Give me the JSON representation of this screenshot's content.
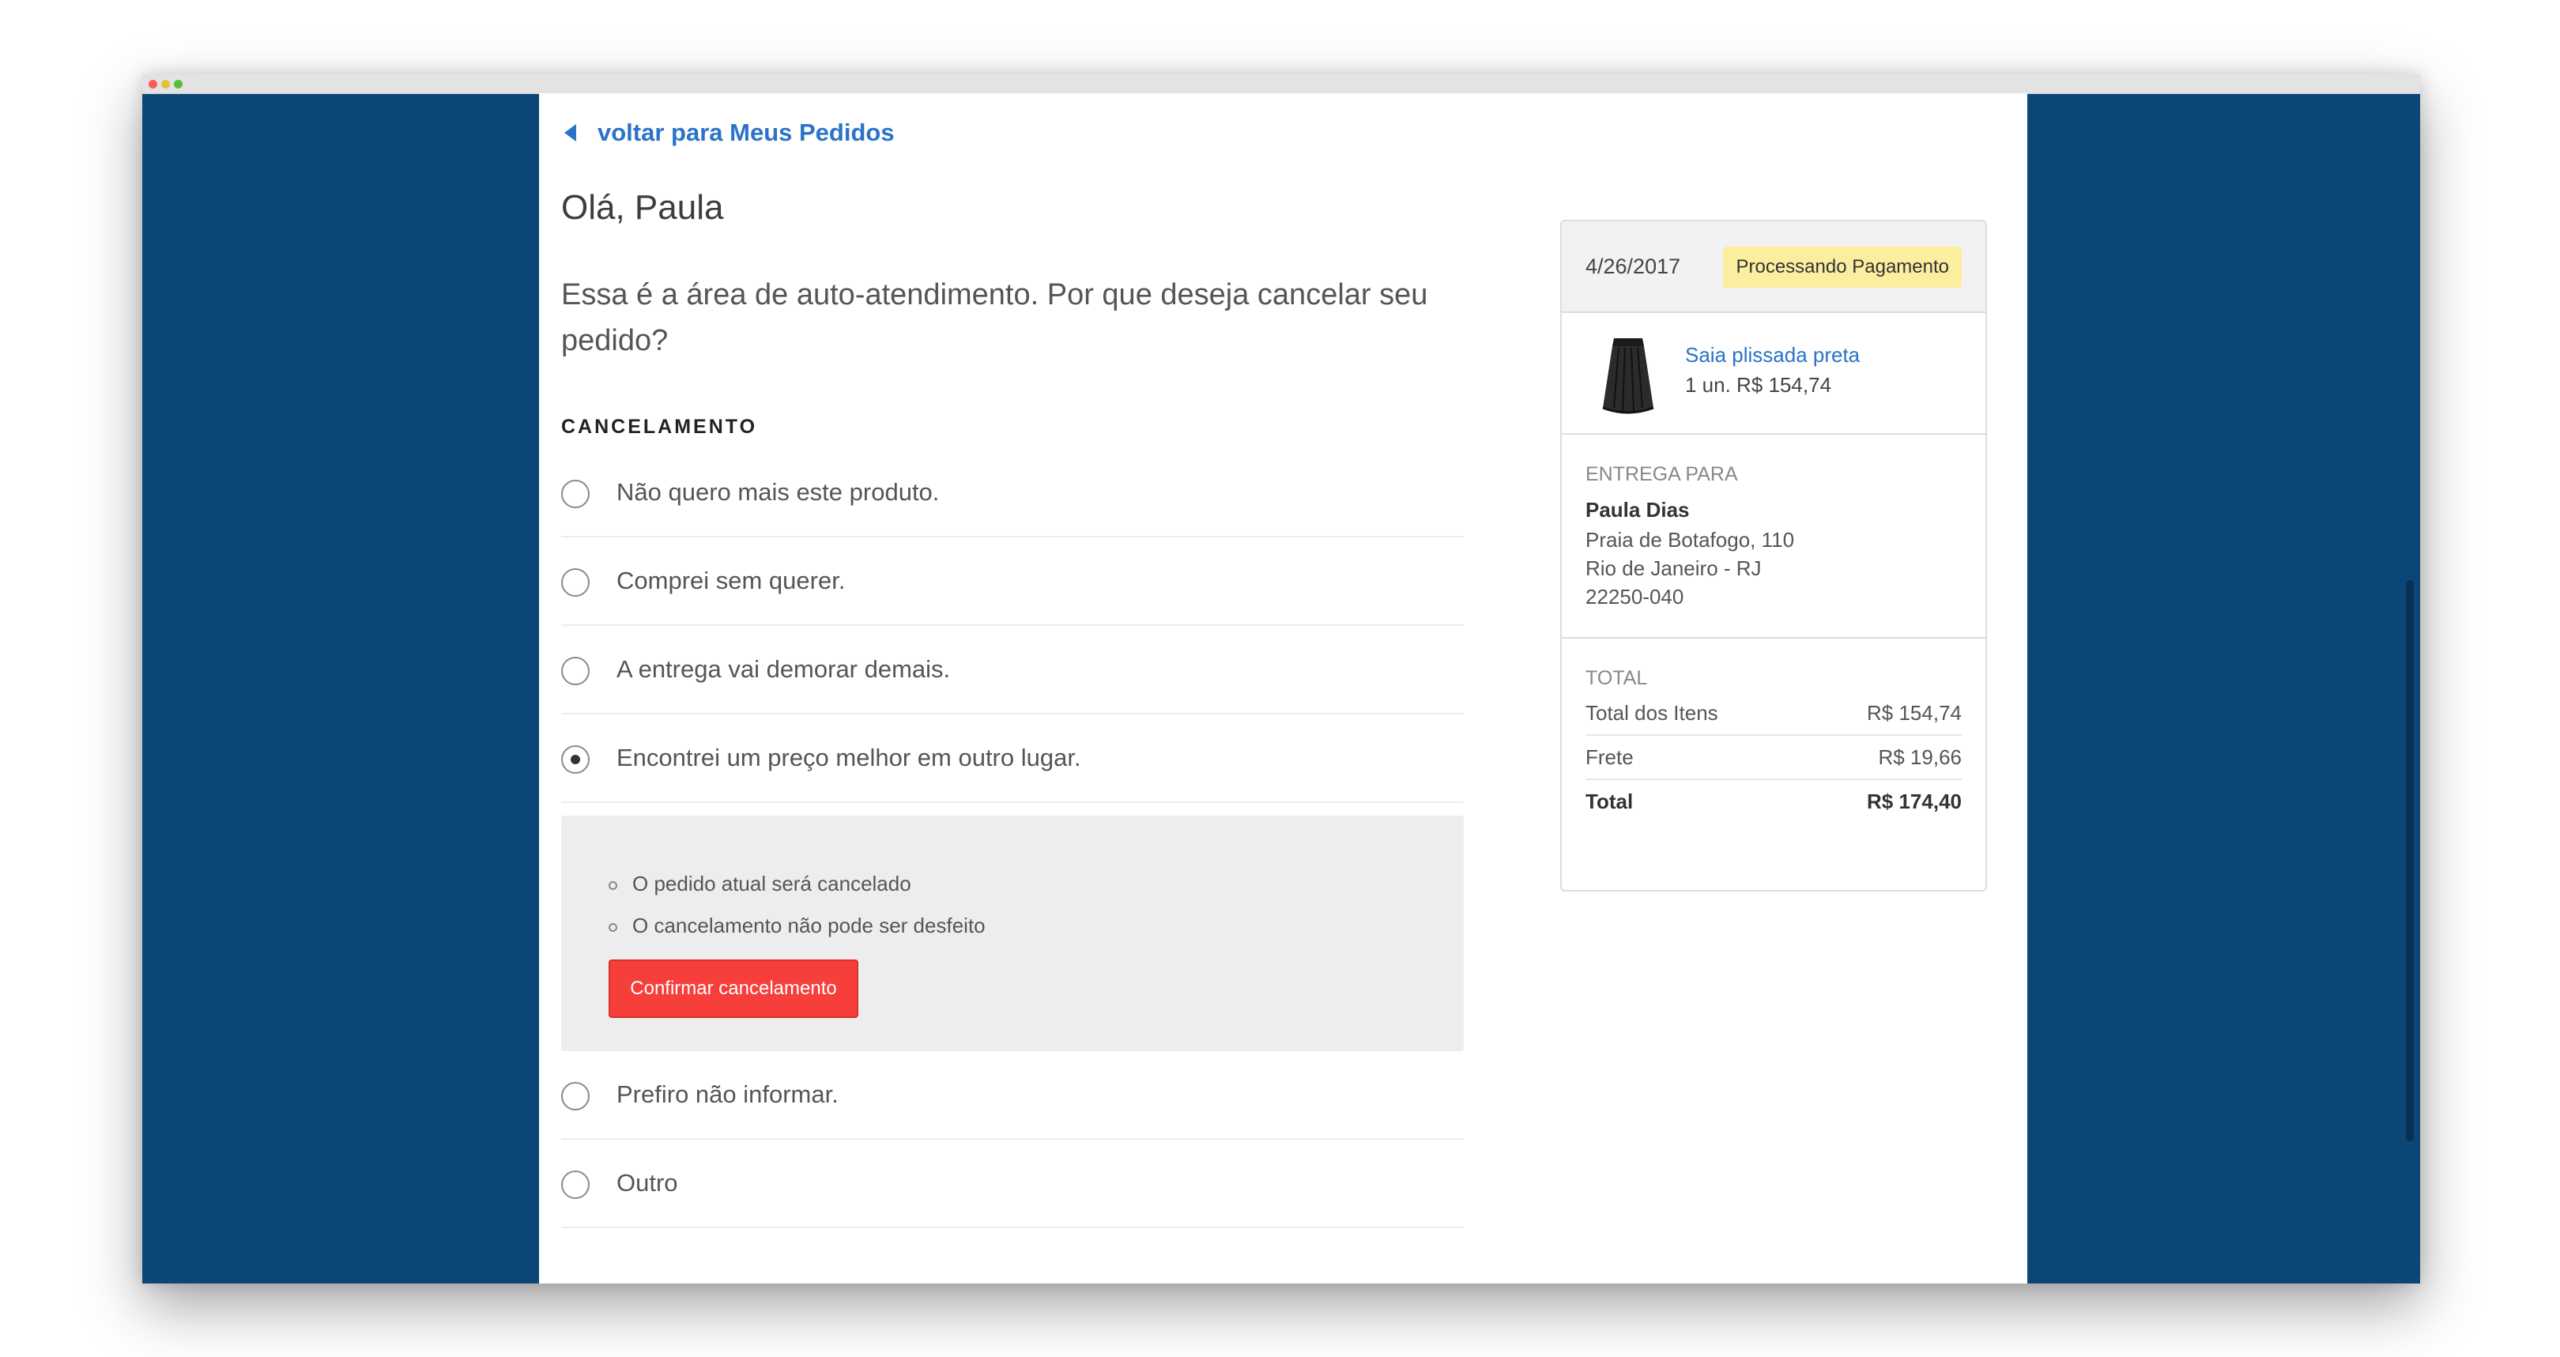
{
  "page": {
    "back_link": "voltar para Meus Pedidos",
    "greeting": "Olá, Paula",
    "intro": "Essa é a área de auto-atendimento. Por que deseja cancelar seu pedido?",
    "section_title": "CANCELAMENTO"
  },
  "options": [
    {
      "label": "Não quero mais este produto.",
      "selected": false
    },
    {
      "label": "Comprei sem querer.",
      "selected": false
    },
    {
      "label": "A entrega vai demorar demais.",
      "selected": false
    },
    {
      "label": "Encontrei um preço melhor em outro lugar.",
      "selected": true
    },
    {
      "label": "Prefiro não informar.",
      "selected": false
    },
    {
      "label": "Outro",
      "selected": false
    }
  ],
  "confirm": {
    "bullets": [
      "O pedido atual será cancelado",
      "O cancelamento não pode ser desfeito"
    ],
    "button": "Confirmar cancelamento"
  },
  "order": {
    "date": "4/26/2017",
    "status": "Processando Pagamento",
    "product_name": "Saia plissada preta",
    "product_qty": "1 un.  R$ 154,74",
    "ship_label": "ENTREGA PARA",
    "ship_name": "Paula Dias",
    "ship_lines": [
      "Praia de Botafogo, 110",
      "Rio de Janeiro - RJ",
      "22250-040"
    ],
    "total_label": "TOTAL",
    "totals": [
      {
        "label": "Total dos Itens",
        "value": "R$ 154,74"
      },
      {
        "label": "Frete",
        "value": "R$ 19,66"
      },
      {
        "label": "Total",
        "value": "R$ 174,40"
      }
    ]
  },
  "colors": {
    "background": "#0c4676",
    "link": "#2a73c8",
    "danger": "#f63e3a",
    "badge": "#fbee9f"
  }
}
